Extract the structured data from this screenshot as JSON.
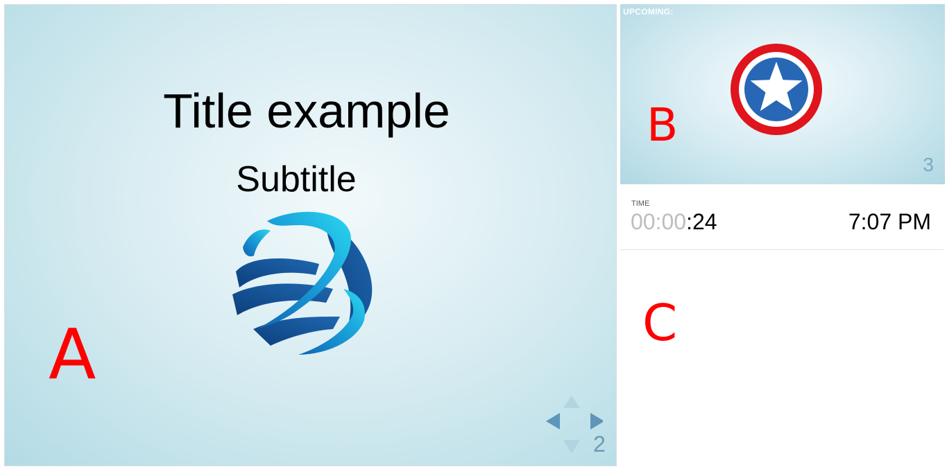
{
  "current_slide": {
    "title": "Title example",
    "subtitle": "Subtitle",
    "slide_number": "2"
  },
  "upcoming_slide": {
    "label": "UPCOMING:",
    "slide_number": "3"
  },
  "time_panel": {
    "label": "TIME",
    "elapsed_dim": "00:00",
    "elapsed_bright": ":24",
    "clock": "7:07 PM"
  },
  "annotations": {
    "a": "A",
    "b": "B",
    "c": "C"
  },
  "colors": {
    "annotation": "#ff0000",
    "nav_arrow_active": "#5e95b9",
    "nav_arrow_disabled": "#a9cfdb",
    "shield_red": "#e0141c",
    "shield_blue": "#2767b6"
  },
  "icons": {
    "current_slide_graphic": "globe-ribbon-logo",
    "upcoming_slide_graphic": "star-shield-logo",
    "navigation": [
      "nav-up-icon",
      "nav-left-icon",
      "nav-right-icon",
      "nav-down-icon"
    ]
  }
}
